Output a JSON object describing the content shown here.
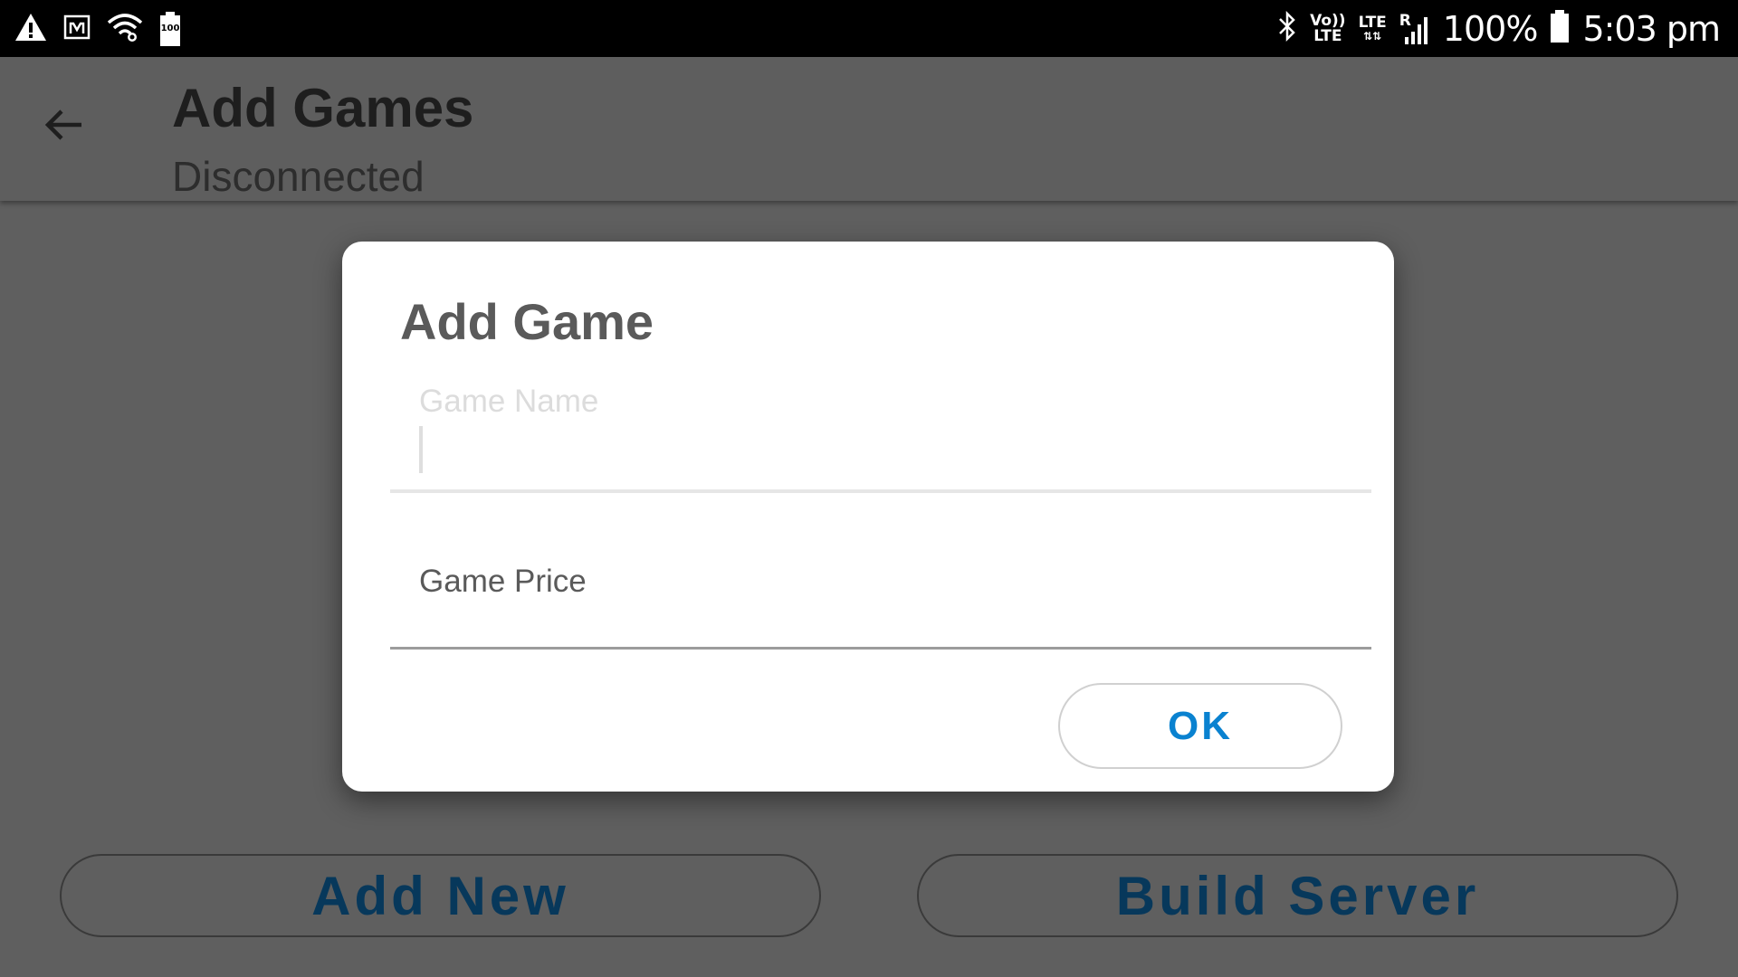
{
  "status_bar": {
    "left_icons": [
      "warning-icon",
      "app-m-icon",
      "wifi-icon",
      "storage-icon"
    ],
    "storage_label": "100",
    "volte_top": "Vo))",
    "volte_bottom": "LTE",
    "lte_label": "LTE",
    "roaming_label": "R",
    "battery": "100%",
    "time": "5:03 pm"
  },
  "app_bar": {
    "title": "Add Games",
    "subtitle": "Disconnected"
  },
  "dialog": {
    "title": "Add Game",
    "game_name": {
      "placeholder": "Game Name",
      "value": ""
    },
    "game_price": {
      "placeholder": "Game Price",
      "value": ""
    },
    "ok_label": "OK"
  },
  "bottom_buttons": {
    "add_new": "Add New",
    "build_server": "Build Server"
  },
  "colors": {
    "overlay_background": "#5f5f5f",
    "accent": "#0a82d0",
    "dimmed_button_text": "#07385b"
  }
}
